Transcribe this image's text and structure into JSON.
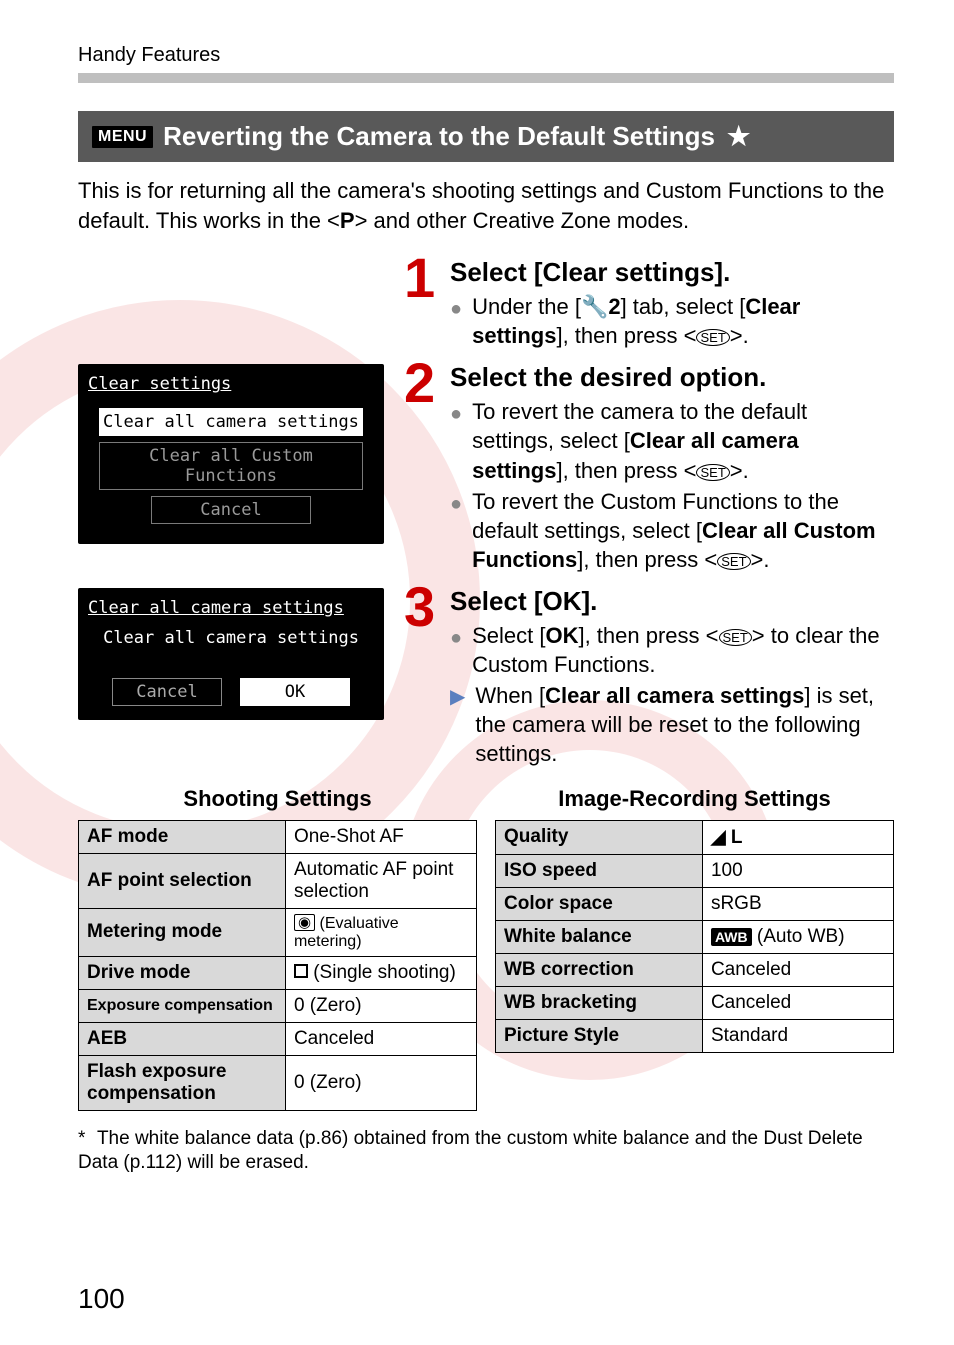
{
  "chapter": "Handy Features",
  "section": {
    "menu_label": "MENU",
    "title": "Reverting the Camera to the Default Settings",
    "star": "★"
  },
  "intro_parts": {
    "a": "This is for returning all the camera's shooting settings and Custom Functions to the default. This works in the <",
    "p": "P",
    "b": "> and other Creative Zone modes."
  },
  "steps": [
    {
      "num": "1",
      "title": "Select [Clear settings].",
      "bullets": [
        {
          "kind": "dot",
          "segments": [
            "Under the [",
            {
              "icon": "wrench",
              "text": "🔧2"
            },
            "] tab, select [",
            {
              "b": "Clear settings"
            },
            "], then press <",
            {
              "icon": "set",
              "text": "SET"
            },
            ">."
          ]
        }
      ],
      "lcd": null
    },
    {
      "num": "2",
      "title": "Select the desired option.",
      "bullets": [
        {
          "kind": "dot",
          "segments": [
            "To revert the camera to the default settings, select [",
            {
              "b": "Clear all camera settings"
            },
            "], then press <",
            {
              "icon": "set",
              "text": "SET"
            },
            ">."
          ]
        },
        {
          "kind": "dot",
          "segments": [
            "To revert the Custom Functions to the default settings, select [",
            {
              "b": "Clear all Custom Functions"
            },
            "], then press <",
            {
              "icon": "set",
              "text": "SET"
            },
            ">."
          ]
        }
      ],
      "lcd": {
        "title": "Clear settings",
        "options": [
          {
            "label": "Clear all camera settings",
            "selected": true
          },
          {
            "label": "Clear all Custom Functions",
            "selected": false
          },
          {
            "label": "Cancel",
            "selected": false,
            "cancel": true
          }
        ]
      }
    },
    {
      "num": "3",
      "title": "Select [OK].",
      "bullets": [
        {
          "kind": "dot",
          "segments": [
            "Select [",
            {
              "b": "OK"
            },
            "], then press <",
            {
              "icon": "set",
              "text": "SET"
            },
            "> to clear the Custom Functions."
          ]
        },
        {
          "kind": "tri",
          "segments": [
            "When [",
            {
              "b": "Clear all camera settings"
            },
            "] is set, the camera will be reset to the following settings."
          ]
        }
      ],
      "lcd2": {
        "headline": "Clear all camera settings",
        "subtitle": "Clear all camera settings",
        "cancel": "Cancel",
        "ok": "OK"
      }
    }
  ],
  "tables": {
    "shooting": {
      "title": "Shooting Settings",
      "rows": [
        {
          "k": "AF mode",
          "v": "One-Shot AF"
        },
        {
          "k": "AF point selection",
          "v": "Automatic AF point selection"
        },
        {
          "k": "Metering mode",
          "v_icon": "eval",
          "v": " (Evaluative metering)",
          "small": true
        },
        {
          "k": "Drive mode",
          "v_icon": "square",
          "v": " (Single shooting)"
        },
        {
          "k": "Exposure compensation",
          "k_small": true,
          "v": "0 (Zero)"
        },
        {
          "k": "AEB",
          "v": "Canceled"
        },
        {
          "k": "Flash exposure compensation",
          "v": "0 (Zero)"
        }
      ]
    },
    "image": {
      "title": "Image-Recording Settings",
      "rows": [
        {
          "k": "Quality",
          "v_icon": "quality",
          "v": " L"
        },
        {
          "k": "ISO speed",
          "v": "100"
        },
        {
          "k": "Color space",
          "v": "sRGB"
        },
        {
          "k": "White balance",
          "v_icon": "awb",
          "v": " (Auto WB)"
        },
        {
          "k": "WB correction",
          "v": "Canceled"
        },
        {
          "k": "WB bracketing",
          "v": "Canceled"
        },
        {
          "k": "Picture Style",
          "v": "Standard"
        }
      ]
    }
  },
  "footnote": "The white balance data (p.86) obtained from the custom white balance and the Dust Delete Data (p.112) will be erased.",
  "page_number": "100"
}
